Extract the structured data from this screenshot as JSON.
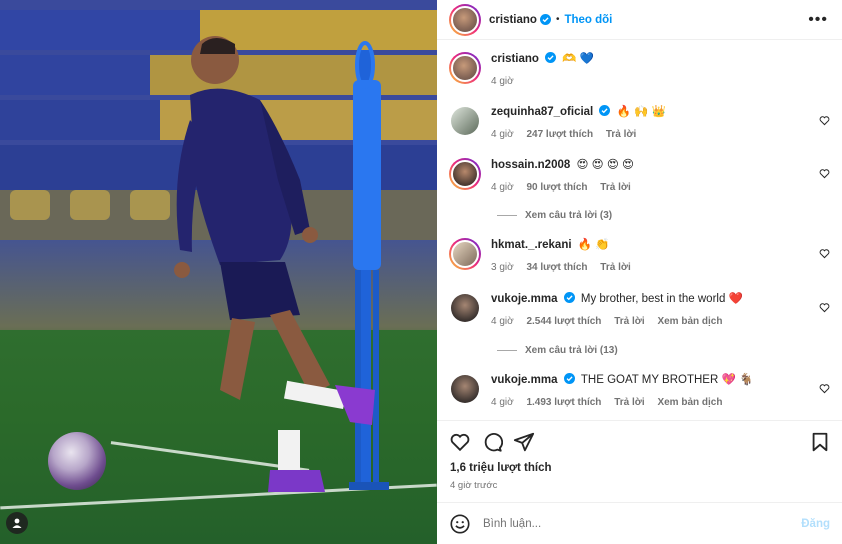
{
  "header": {
    "username": "cristiano",
    "separator": "•",
    "follow_label": "Theo dõi",
    "more_icon": "more-horizontal-icon"
  },
  "caption": {
    "username": "cristiano",
    "emojis": "🫶 💙",
    "time": "4 giờ"
  },
  "comments": [
    {
      "username": "zequinha87_oficial",
      "verified": true,
      "text": "🔥 🙌 👑",
      "time": "4 giờ",
      "likes": "247 lượt thích",
      "reply": "Trả lời",
      "translate": ""
    },
    {
      "username": "hossain.n2008",
      "verified": false,
      "text": "😍 😍 😍 😍",
      "time": "4 giờ",
      "likes": "90 lượt thích",
      "reply": "Trả lời",
      "translate": "",
      "view_replies": "Xem câu trả lời (3)"
    },
    {
      "username": "hkmat._.rekani",
      "verified": false,
      "text": "🔥 👏",
      "time": "3 giờ",
      "likes": "34 lượt thích",
      "reply": "Trả lời",
      "translate": ""
    },
    {
      "username": "vukoje.mma",
      "verified": true,
      "text": "My brother, best in the world ❤️",
      "time": "4 giờ",
      "likes": "2.544 lượt thích",
      "reply": "Trả lời",
      "translate": "Xem bản dịch",
      "view_replies": "Xem câu trả lời (13)"
    },
    {
      "username": "vukoje.mma",
      "verified": true,
      "text": "THE GOAT MY BROTHER 💖 🐐",
      "time": "4 giờ",
      "likes": "1.493 lượt thích",
      "reply": "Trả lời",
      "translate": "Xem bản dịch"
    }
  ],
  "actions": {
    "like_icon": "heart-icon",
    "comment_icon": "comment-icon",
    "share_icon": "share-icon",
    "save_icon": "bookmark-icon"
  },
  "likes_count": "1,6 triệu lượt thích",
  "posted_ago": "4 giờ trước",
  "composer": {
    "placeholder": "Bình luận...",
    "post_label": "Đăng"
  },
  "colors": {
    "accent": "#0095f6",
    "post_disabled": "#b2dffc",
    "muted": "#737373"
  }
}
